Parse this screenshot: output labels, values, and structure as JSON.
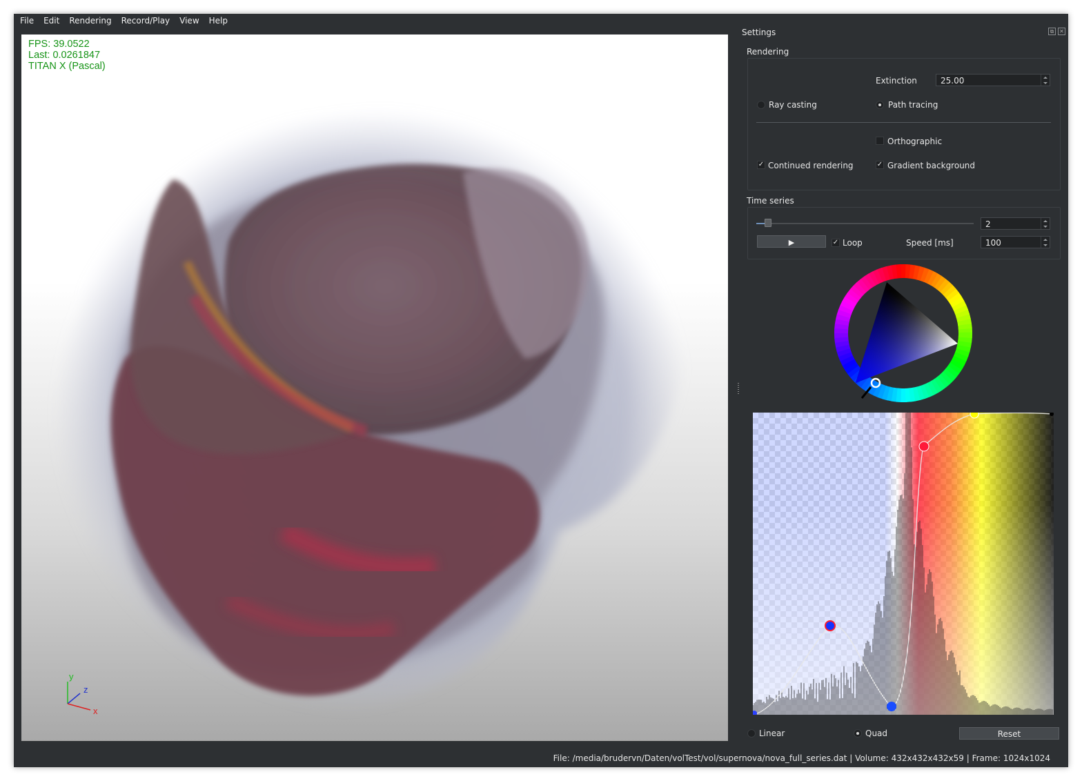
{
  "menu": [
    "File",
    "Edit",
    "Rendering",
    "Record/Play",
    "View",
    "Help"
  ],
  "overlay": {
    "fps": "FPS: 39.0522",
    "last": "Last: 0.0261847",
    "gpu": "TITAN X (Pascal)"
  },
  "axes": {
    "x": "x",
    "y": "y",
    "z": "z"
  },
  "settings": {
    "title": "Settings",
    "rendering": {
      "title": "Rendering",
      "extinction_label": "Extinction",
      "extinction_value": "25.00",
      "ray_casting": "Ray casting",
      "path_tracing": "Path tracing",
      "mode_selected": "Path tracing",
      "orthographic": "Orthographic",
      "orthographic_checked": false,
      "continued_rendering": "Continued rendering",
      "continued_rendering_checked": true,
      "gradient_background": "Gradient background",
      "gradient_background_checked": true
    },
    "time_series": {
      "title": "Time series",
      "frame_value": "2",
      "frame_progress": 0.03,
      "play_icon": "play-icon",
      "play_glyph": "▶",
      "loop": "Loop",
      "loop_checked": true,
      "speed_label": "Speed [ms]",
      "speed_value": "100"
    },
    "color_wheel": {
      "selected_color": "#0000c8"
    },
    "transfer_function": {
      "interpolation_linear": "Linear",
      "interpolation_quad": "Quad",
      "interpolation_selected": "Quad",
      "reset": "Reset"
    }
  },
  "status": "File: /media/brudervn/Daten/volTest/vol/supernova/nova_full_series.dat | Volume: 432x432x432x59 | Frame: 1024x1024"
}
